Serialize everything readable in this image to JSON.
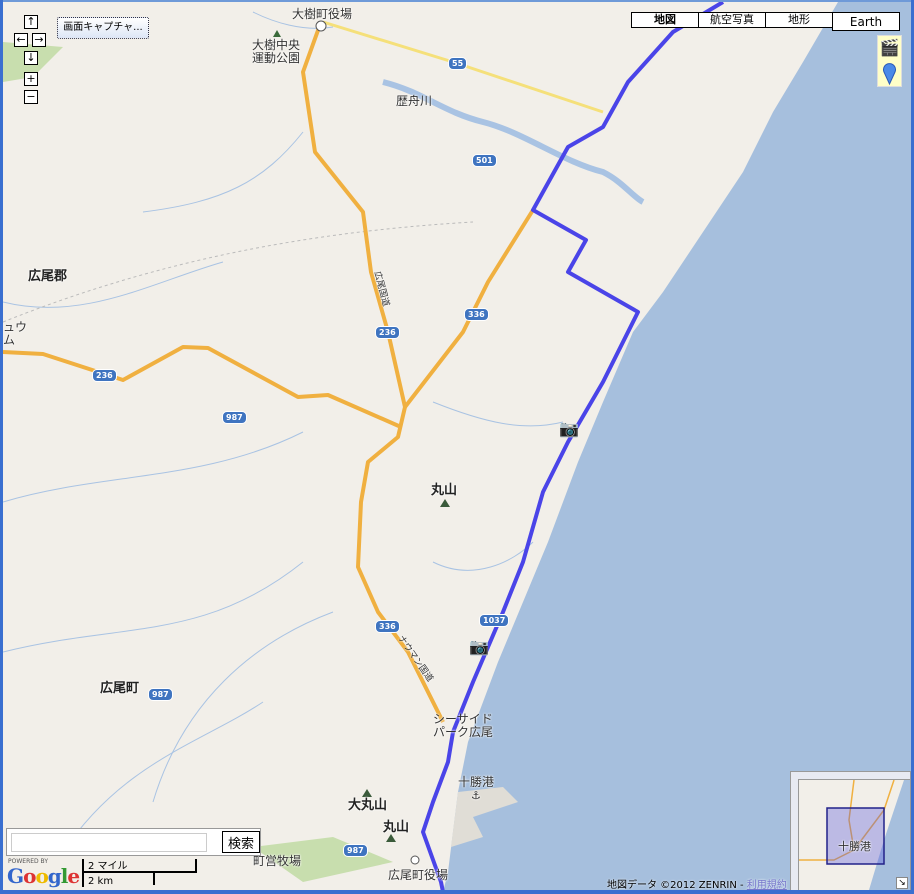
{
  "map_type_buttons": [
    {
      "label": "地図",
      "selected": true
    },
    {
      "label": "航空写真"
    },
    {
      "label": "地形"
    },
    {
      "label": "Earth"
    }
  ],
  "controls": {
    "pan_up": "↑",
    "pan_left": "←",
    "pan_right": "→",
    "pan_down": "↓",
    "zoom_in": "+",
    "zoom_out": "−",
    "capture_label": "画面キャプチャ..."
  },
  "labels": {
    "taiki_office": "大樹町役場",
    "taiki_park_1": "大樹中央",
    "taiki_park_2": "運動公園",
    "rekifune": "歴舟川",
    "hiroo_gun": "広尾郡",
    "partial_1": "ュウ",
    "partial_2": "ム",
    "maruyama": "丸山",
    "hiroo_cho": "広尾町",
    "seaside_1": "シーサイド",
    "seaside_2": "パーク広尾",
    "tokachi_port": "十勝港",
    "omaruyama": "大丸山",
    "maruyama2": "丸山",
    "ranch": "町営牧場",
    "hiroo_office": "広尾町役場",
    "hiroo_road": "広尾国道",
    "ougon_road": "ナウマン国道"
  },
  "road_shields": [
    "55",
    "501",
    "236",
    "336",
    "236",
    "987",
    "987",
    "1037",
    "336",
    "987"
  ],
  "search": {
    "value": "",
    "button": "検索"
  },
  "branding": {
    "powered": "POWERED BY",
    "logo": "Google"
  },
  "scale": {
    "miles": "2 マイル",
    "km": "2 km"
  },
  "copyright": {
    "text": "地図データ ©2012 ZENRIN - ",
    "terms": "利用規約"
  },
  "overview": {
    "label": "十勝港"
  },
  "colors": {
    "route": "#4a44e8",
    "highway": "#f0b040",
    "sea": "#a6bfdd",
    "land": "#f2efe9",
    "river": "#a9c3e3"
  }
}
